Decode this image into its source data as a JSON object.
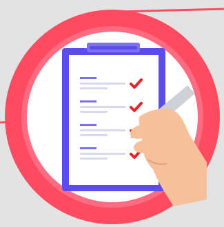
{
  "colors": {
    "background": "#e3e3e3",
    "ring_outer": "#ff4b5f",
    "ring_inner": "#ff6b80",
    "accent_line": "#ff4b5f",
    "clipboard_frame": "#5b4ee8",
    "clipboard_clip": "#7c72f0",
    "paper": "#ffffff",
    "item_heading": "#7c72f0",
    "item_line": "#d9d9ec",
    "check": "#e5252a",
    "skin": "#f5c09a",
    "skin_shade": "#e0a27b",
    "pen_body": "#cfd1d6",
    "pen_grip": "#eef0f2"
  },
  "icons": {
    "main": "clipboard-checklist-icon",
    "mark": "checkmark-icon",
    "tool": "pencil-icon"
  },
  "checklist": {
    "items": [
      {
        "checked": true
      },
      {
        "checked": true
      },
      {
        "checked": true
      },
      {
        "checked": true
      }
    ]
  }
}
